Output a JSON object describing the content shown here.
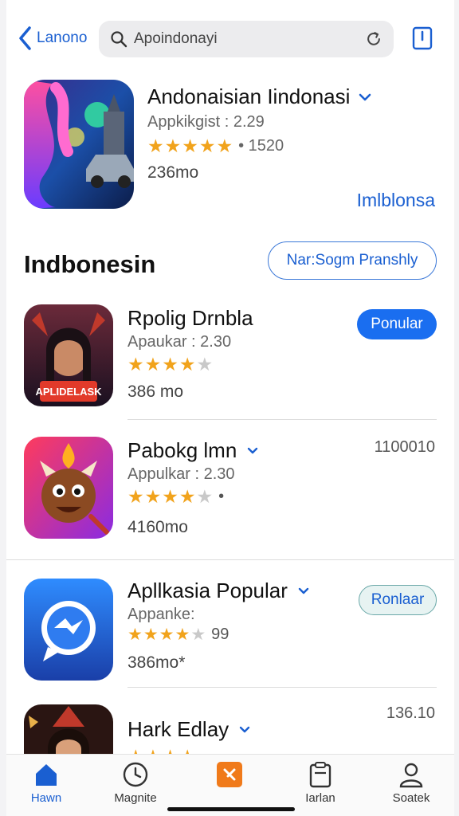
{
  "header": {
    "back_label": "Lanono",
    "search_value": "Apoindonayi"
  },
  "featured": {
    "title": "Andonaisian Iindonasi",
    "subtitle": "Appkikgist : 2.29",
    "rating_count": "1520",
    "size": "236mo",
    "link": "Imlblonsa"
  },
  "section": {
    "title": "Indbonesin",
    "button": "Nar:Sogm Pranshly"
  },
  "apps": [
    {
      "name": "Rpolig Drnbla",
      "subtitle": "Apaukar : 2.30",
      "rating": 3.5,
      "rating_extra": "",
      "size": "386 mo",
      "button": "Ponular",
      "number": ""
    },
    {
      "name": "Pabokg lmn",
      "subtitle": "Appulkar : 2.30",
      "rating": 4,
      "rating_extra": "•",
      "size": "4160mo",
      "button": "",
      "number": "1100010"
    },
    {
      "name": "Apllkasia Popular",
      "subtitle": "Appanke:",
      "rating": 3.5,
      "rating_extra": "99",
      "size": "386mo*",
      "button": "Ronlaar",
      "number": ""
    },
    {
      "name": "Hark Edlay",
      "subtitle": "",
      "rating": 4,
      "rating_extra": "",
      "size": "",
      "button": "",
      "number": "136.10"
    }
  ],
  "tabs": [
    {
      "label": "Hawn",
      "icon": "home-icon"
    },
    {
      "label": "Magnite",
      "icon": "clock-icon"
    },
    {
      "label": "",
      "icon": "app-icon"
    },
    {
      "label": "Iarlan",
      "icon": "clipboard-icon"
    },
    {
      "label": "Soatek",
      "icon": "person-icon"
    }
  ],
  "colors": {
    "accent": "#1a6ef0",
    "star": "#f1a31c"
  }
}
